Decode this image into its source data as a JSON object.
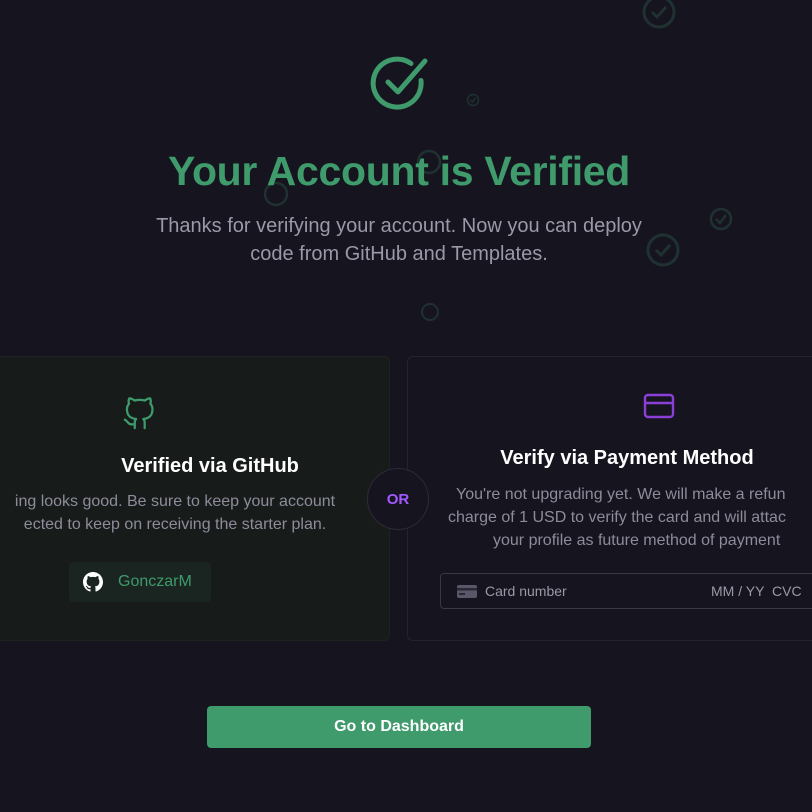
{
  "header": {
    "icon": "check-circle-icon",
    "title": "Your Account is Verified",
    "subtitle": "Thanks for verifying your account. Now you can deploy code from GitHub and Templates."
  },
  "github_card": {
    "icon": "github-icon",
    "title": "Verified via GitHub",
    "description_line1": "ing looks good. Be sure to keep your account",
    "description_line2": "ected to keep on receiving the starter plan.",
    "username": "GonczarM"
  },
  "or_label": "OR",
  "payment_card": {
    "icon": "credit-card-icon",
    "title": "Verify via Payment Method",
    "description_line1": "You're not upgrading yet. We will make a refun",
    "description_line2": "charge of 1 USD to verify the card and will attac",
    "description_line3": "your profile as future method of payment",
    "card_number_placeholder": "Card number",
    "expiry_placeholder": "MM / YY",
    "cvc_placeholder": "CVC"
  },
  "cta": {
    "label": "Go to Dashboard"
  },
  "colors": {
    "background": "#16141f",
    "accent_green": "#3f9a6c",
    "accent_purple": "#a259ff",
    "text_muted": "#9b98a8"
  }
}
